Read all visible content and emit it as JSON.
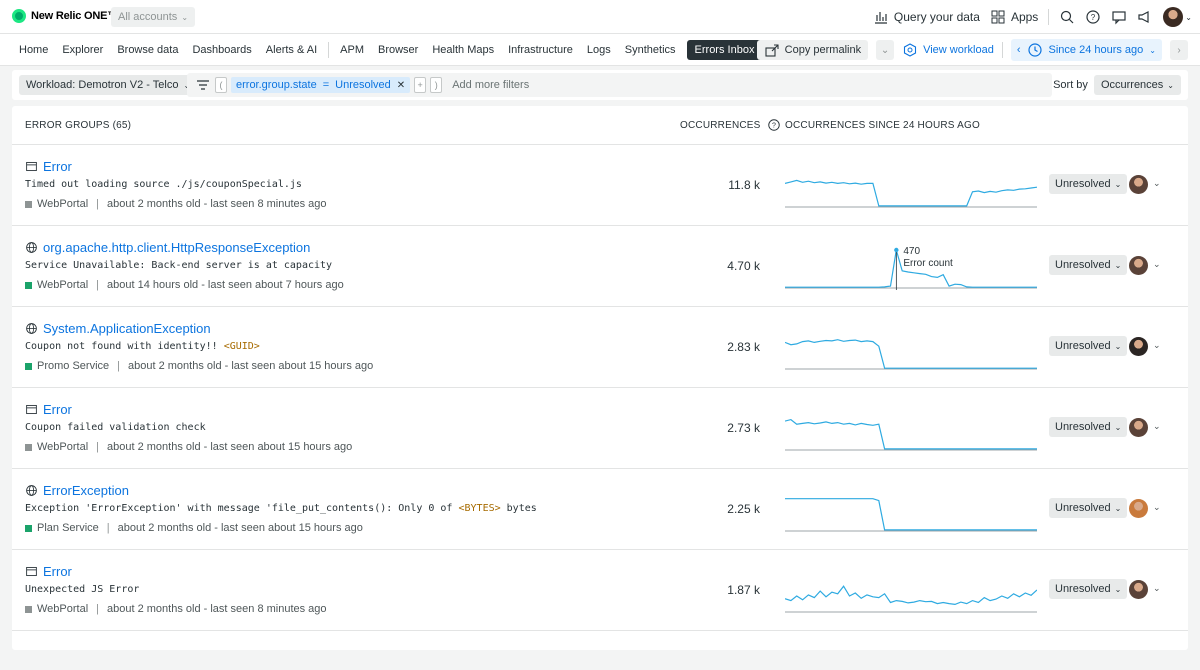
{
  "topbar": {
    "brand": "New Relic ONE™",
    "accounts": "All accounts",
    "query_your_data": "Query your data",
    "apps": "Apps"
  },
  "nav": {
    "items": [
      "Home",
      "Explorer",
      "Browse data",
      "Dashboards",
      "Alerts & AI"
    ],
    "items2": [
      "APM",
      "Browser",
      "Health Maps",
      "Infrastructure",
      "Logs",
      "Synthetics"
    ],
    "active": "Errors Inbox",
    "copy_permalink": "Copy permalink",
    "view_workload": "View workload",
    "time_range": "Since 24 hours ago"
  },
  "filters": {
    "workload": "Workload: Demotron V2 - Telco",
    "attr": "error.group.state",
    "op": "=",
    "value": "Unresolved",
    "add_more": "Add more filters",
    "sort_by_label": "Sort by",
    "sort_value": "Occurrences"
  },
  "table": {
    "col_groups": "ERROR GROUPS (65)",
    "col_occurrences": "OCCURRENCES",
    "col_since": "OCCURRENCES SINCE 24 HOURS AGO",
    "rows": [
      {
        "type_icon": "window-icon",
        "title": "Error",
        "message": "Timed out loading source ./js/couponSpecial.js",
        "message_token": "",
        "service": "WebPortal",
        "service_color": "#8e9494",
        "age": "about 2 months old - last seen 8 minutes ago",
        "count": "11.8 k",
        "status": "Unresolved",
        "spark": [
          0.62,
          0.66,
          0.7,
          0.65,
          0.68,
          0.64,
          0.66,
          0.63,
          0.65,
          0.62,
          0.64,
          0.61,
          0.63,
          0.6,
          0.62,
          0.62,
          0.03,
          0.03,
          0.03,
          0.03,
          0.03,
          0.03,
          0.03,
          0.03,
          0.03,
          0.03,
          0.03,
          0.03,
          0.03,
          0.03,
          0.03,
          0.03,
          0.4,
          0.42,
          0.38,
          0.41,
          0.39,
          0.43,
          0.45,
          0.44,
          0.47,
          0.48,
          0.5,
          0.52
        ]
      },
      {
        "type_icon": "globe-icon",
        "title": "org.apache.http.client.HttpResponseException",
        "message": "Service Unavailable: Back-end server is at capacity",
        "message_token": "",
        "service": "WebPortal",
        "service_color": "#1ba36a",
        "age": "about 14 hours old - last seen about 7 hours ago",
        "count": "4.70 k",
        "status": "Unresolved",
        "tooltip_value": "470",
        "tooltip_label": "Error count",
        "spark": [
          0.02,
          0.02,
          0.02,
          0.02,
          0.02,
          0.02,
          0.02,
          0.02,
          0.02,
          0.02,
          0.02,
          0.02,
          0.02,
          0.02,
          0.02,
          0.02,
          0.02,
          0.03,
          0.05,
          1.0,
          0.45,
          0.42,
          0.4,
          0.38,
          0.36,
          0.3,
          0.28,
          0.35,
          0.05,
          0.1,
          0.09,
          0.03,
          0.02,
          0.02,
          0.02,
          0.02,
          0.02,
          0.02,
          0.02,
          0.02,
          0.02,
          0.02,
          0.02,
          0.02
        ]
      },
      {
        "type_icon": "globe-icon",
        "title": "System.ApplicationException",
        "message": "Coupon not found with identity!! ",
        "message_token": "<GUID>",
        "service": "Promo Service",
        "service_color": "#1ba36a",
        "age": "about 2 months old - last seen about 15 hours ago",
        "count": "2.83 k",
        "status": "Unresolved",
        "spark": [
          0.7,
          0.64,
          0.66,
          0.72,
          0.74,
          0.7,
          0.73,
          0.75,
          0.74,
          0.77,
          0.73,
          0.75,
          0.76,
          0.72,
          0.74,
          0.72,
          0.6,
          0.02,
          0.02,
          0.02,
          0.02,
          0.02,
          0.02,
          0.02,
          0.02,
          0.02,
          0.02,
          0.02,
          0.02,
          0.02,
          0.02,
          0.02,
          0.02,
          0.02,
          0.02,
          0.02,
          0.02,
          0.02,
          0.02,
          0.02,
          0.02,
          0.02,
          0.02,
          0.02
        ]
      },
      {
        "type_icon": "window-icon",
        "title": "Error",
        "message": "Coupon failed validation check",
        "message_token": "",
        "service": "WebPortal",
        "service_color": "#8e9494",
        "age": "about 2 months old - last seen about 15 hours ago",
        "count": "2.73 k",
        "status": "Unresolved",
        "spark": [
          0.76,
          0.8,
          0.68,
          0.7,
          0.72,
          0.69,
          0.71,
          0.74,
          0.7,
          0.72,
          0.68,
          0.7,
          0.66,
          0.7,
          0.67,
          0.65,
          0.68,
          0.03,
          0.03,
          0.03,
          0.03,
          0.03,
          0.03,
          0.03,
          0.03,
          0.03,
          0.03,
          0.03,
          0.03,
          0.03,
          0.03,
          0.03,
          0.03,
          0.03,
          0.03,
          0.03,
          0.03,
          0.03,
          0.03,
          0.03,
          0.03,
          0.03,
          0.03,
          0.03
        ]
      },
      {
        "type_icon": "globe-icon",
        "title": "ErrorException",
        "message": "Exception 'ErrorException' with message 'file_put_contents(): Only 0 of ",
        "message_token": "<BYTES>",
        "message_tail": " bytes",
        "service": "Plan Service",
        "service_color": "#1ba36a",
        "age": "about 2 months old - last seen about 15 hours ago",
        "count": "2.25 k",
        "status": "Unresolved",
        "spark": [
          0.85,
          0.85,
          0.85,
          0.85,
          0.85,
          0.85,
          0.85,
          0.85,
          0.85,
          0.85,
          0.85,
          0.85,
          0.85,
          0.85,
          0.85,
          0.85,
          0.8,
          0.03,
          0.03,
          0.03,
          0.03,
          0.03,
          0.03,
          0.03,
          0.03,
          0.03,
          0.03,
          0.03,
          0.03,
          0.03,
          0.03,
          0.03,
          0.03,
          0.03,
          0.03,
          0.03,
          0.03,
          0.03,
          0.03,
          0.03,
          0.03,
          0.03,
          0.03,
          0.03
        ]
      },
      {
        "type_icon": "window-icon",
        "title": "Error",
        "message": "Unexpected JS Error",
        "message_token": "",
        "service": "WebPortal",
        "service_color": "#8e9494",
        "age": "about 2 months old - last seen 8 minutes ago",
        "count": "1.87 k",
        "status": "Unresolved",
        "spark": [
          0.35,
          0.3,
          0.42,
          0.32,
          0.45,
          0.38,
          0.55,
          0.4,
          0.52,
          0.48,
          0.68,
          0.42,
          0.5,
          0.36,
          0.45,
          0.4,
          0.38,
          0.48,
          0.25,
          0.3,
          0.28,
          0.24,
          0.26,
          0.3,
          0.27,
          0.28,
          0.22,
          0.25,
          0.22,
          0.2,
          0.26,
          0.22,
          0.3,
          0.25,
          0.38,
          0.3,
          0.34,
          0.42,
          0.36,
          0.48,
          0.4,
          0.5,
          0.44,
          0.58
        ]
      }
    ]
  },
  "colors": {
    "accent": "#0c74df",
    "spark": "#2eaae1",
    "avatars": [
      "#5a4238",
      "#5a4238",
      "#2b2523",
      "#5a4238",
      "#c97a3c",
      "#5a4238"
    ]
  }
}
